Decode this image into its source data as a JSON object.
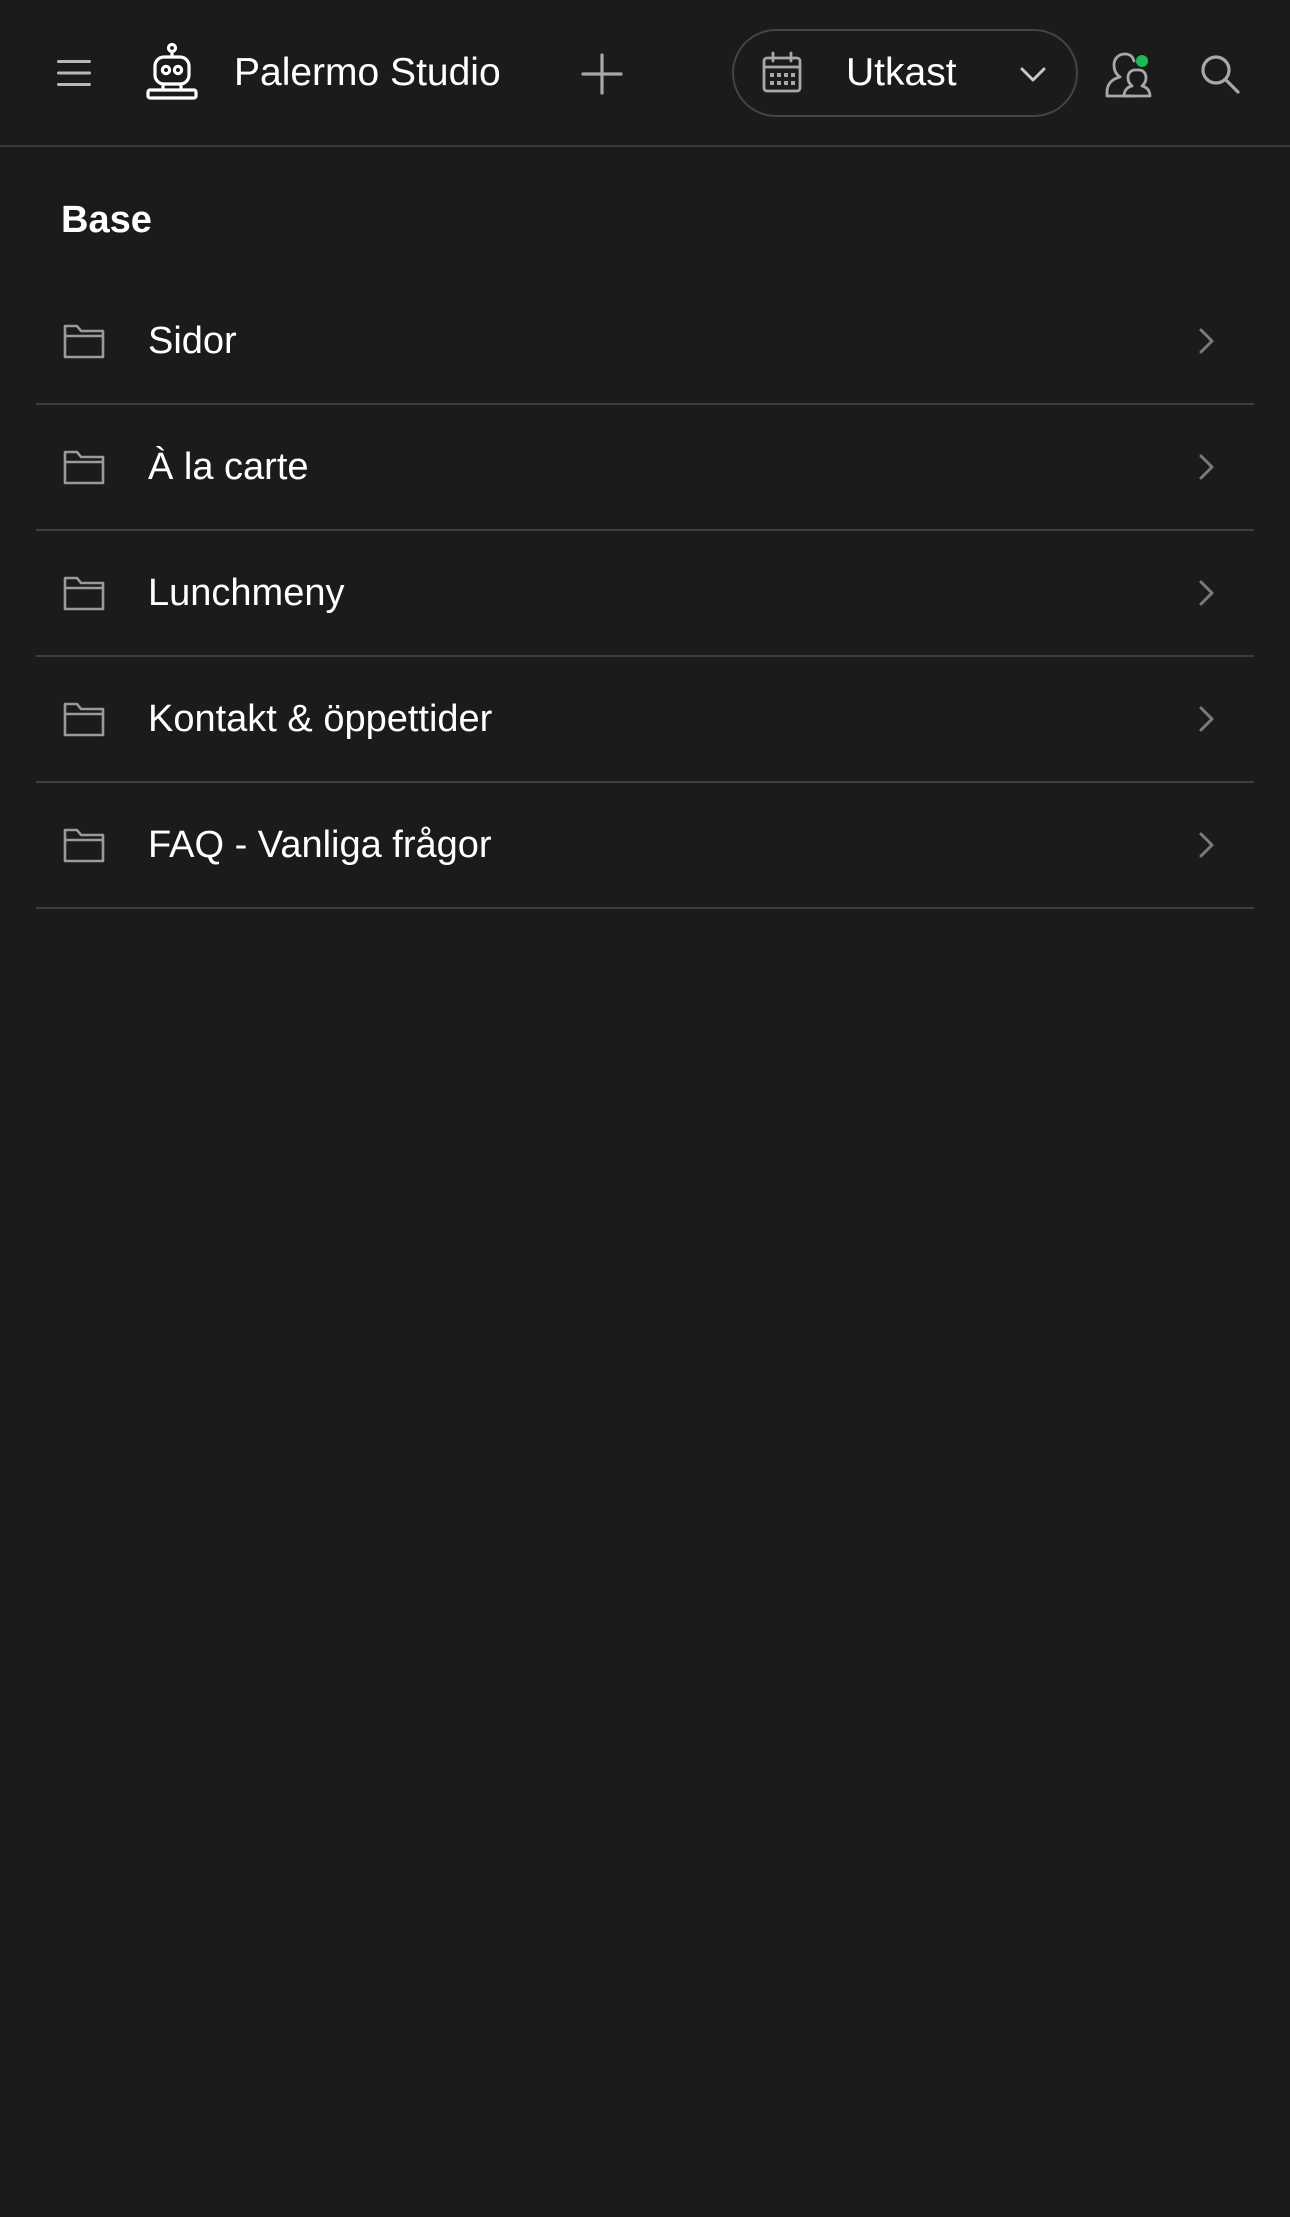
{
  "header": {
    "app_title": "Palermo Studio",
    "status": {
      "label": "Utkast"
    },
    "icons": {
      "menu": "hamburger-icon",
      "logo": "robot-icon",
      "add": "plus-icon",
      "calendar": "calendar-icon",
      "chevron": "chevron-down-icon",
      "users": "users-icon",
      "search": "search-icon"
    },
    "presence_color": "#1db954"
  },
  "section": {
    "title": "Base"
  },
  "folders": [
    {
      "label": "Sidor"
    },
    {
      "label": "À la carte"
    },
    {
      "label": "Lunchmeny"
    },
    {
      "label": "Kontakt & öppettider"
    },
    {
      "label": "FAQ - Vanliga frågor"
    }
  ],
  "colors": {
    "background": "#1b1b1b",
    "divider": "#3d3d3d",
    "icon": "#9a9a9a",
    "text": "#ffffff"
  }
}
